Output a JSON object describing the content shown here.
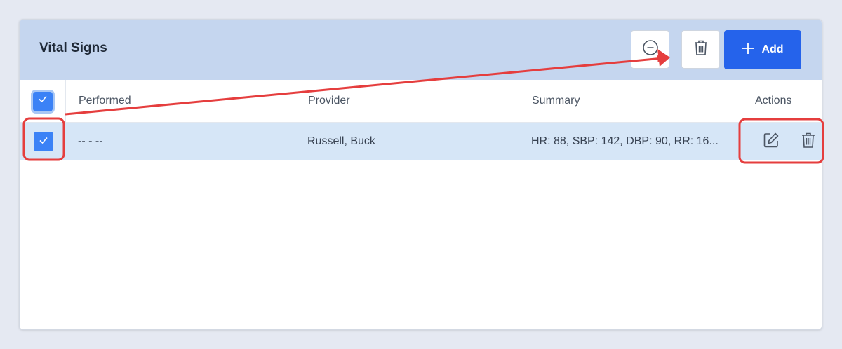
{
  "panel": {
    "title": "Vital Signs",
    "add_label": "Add"
  },
  "table": {
    "columns": [
      "Performed",
      "Provider",
      "Summary",
      "Actions"
    ],
    "rows": [
      {
        "performed": "-- - --",
        "provider": "Russell, Buck",
        "summary": "HR: 88, SBP: 142, DBP: 90, RR: 16..."
      }
    ]
  },
  "colors": {
    "header_bg": "#c5d6ef",
    "row_selected_bg": "#d6e6f7",
    "primary": "#2563eb",
    "annotation": "#e53e3e"
  },
  "icons": {
    "collapse": "minus-circle-icon",
    "delete": "trash-icon",
    "add": "plus-icon",
    "edit": "edit-icon",
    "check": "check-icon"
  }
}
